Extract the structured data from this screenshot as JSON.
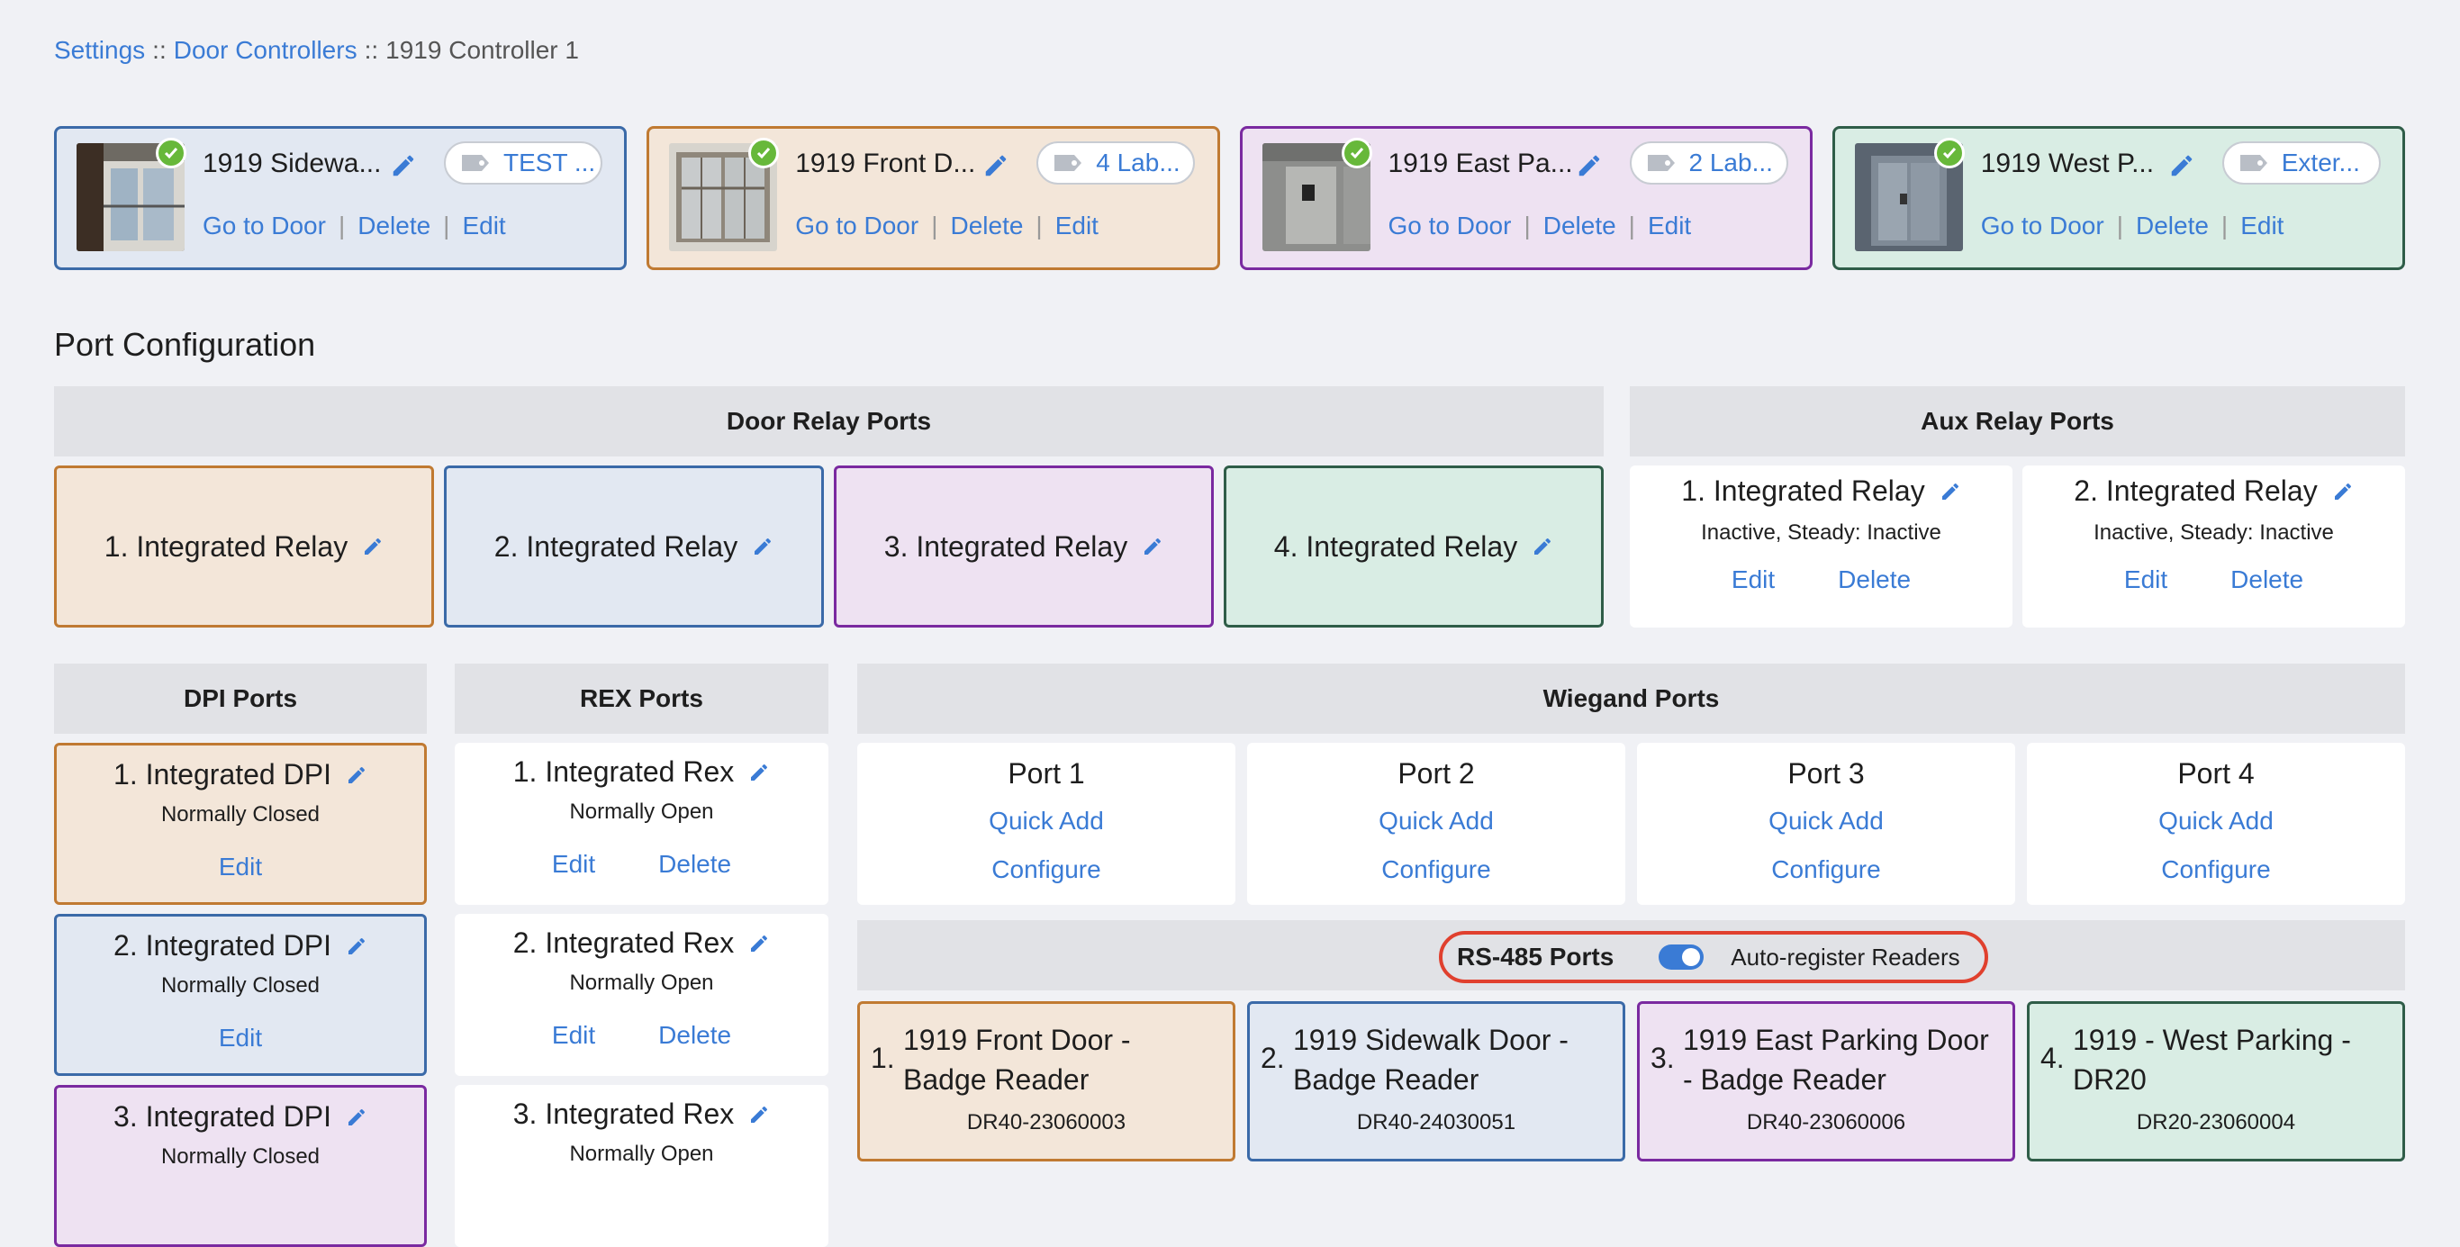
{
  "breadcrumb": {
    "items": [
      "Settings",
      "Door Controllers"
    ],
    "current": "1919 Controller 1",
    "separator": "::"
  },
  "door_cards": [
    {
      "name": "1919 Sidewa...",
      "tag": "TEST ...",
      "go": "Go to Door",
      "del": "Delete",
      "edit": "Edit",
      "color": "#3b6aa8",
      "bg": "#e2e8f2"
    },
    {
      "name": "1919 Front D...",
      "tag": "4 Lab...",
      "go": "Go to Door",
      "del": "Delete",
      "edit": "Edit",
      "color": "#c07a32",
      "bg": "#f3e6d9"
    },
    {
      "name": "1919 East Pa...",
      "tag": "2 Lab...",
      "go": "Go to Door",
      "del": "Delete",
      "edit": "Edit",
      "color": "#7a2aa0",
      "bg": "#eee2f2"
    },
    {
      "name": "1919 West P...",
      "tag": "Exter...",
      "go": "Go to Door",
      "del": "Delete",
      "edit": "Edit",
      "color": "#2f5d48",
      "bg": "#d9ede4"
    }
  ],
  "section_title": "Port Configuration",
  "door_relay": {
    "header": "Door Relay Ports",
    "items": [
      "1. Integrated Relay",
      "2. Integrated Relay",
      "3. Integrated Relay",
      "4. Integrated Relay"
    ]
  },
  "aux_relay": {
    "header": "Aux Relay Ports",
    "items": [
      {
        "title": "1. Integrated Relay",
        "status": "Inactive, Steady: Inactive",
        "edit": "Edit",
        "del": "Delete"
      },
      {
        "title": "2. Integrated Relay",
        "status": "Inactive, Steady: Inactive",
        "edit": "Edit",
        "del": "Delete"
      }
    ]
  },
  "dpi": {
    "header": "DPI Ports",
    "items": [
      {
        "title": "1. Integrated DPI",
        "status": "Normally Closed",
        "edit": "Edit"
      },
      {
        "title": "2. Integrated DPI",
        "status": "Normally Closed",
        "edit": "Edit"
      },
      {
        "title": "3. Integrated DPI",
        "status": "Normally Closed"
      }
    ]
  },
  "rex": {
    "header": "REX Ports",
    "items": [
      {
        "title": "1. Integrated Rex",
        "status": "Normally Open",
        "edit": "Edit",
        "del": "Delete"
      },
      {
        "title": "2. Integrated Rex",
        "status": "Normally Open",
        "edit": "Edit",
        "del": "Delete"
      },
      {
        "title": "3. Integrated Rex",
        "status": "Normally Open"
      }
    ]
  },
  "wiegand": {
    "header": "Wiegand Ports",
    "items": [
      {
        "title": "Port 1",
        "quick": "Quick Add",
        "configure": "Configure"
      },
      {
        "title": "Port 2",
        "quick": "Quick Add",
        "configure": "Configure"
      },
      {
        "title": "Port 3",
        "quick": "Quick Add",
        "configure": "Configure"
      },
      {
        "title": "Port 4",
        "quick": "Quick Add",
        "configure": "Configure"
      }
    ]
  },
  "rs485": {
    "label": "RS-485 Ports",
    "auto_register": "Auto-register Readers",
    "auto_register_enabled": true,
    "readers": [
      {
        "num": "1.",
        "name_line1": "1919 Front Door -",
        "name_line2": "Badge Reader",
        "serial": "DR40-23060003"
      },
      {
        "num": "2.",
        "name_line1": "1919 Sidewalk Door -",
        "name_line2": "Badge Reader",
        "serial": "DR40-24030051"
      },
      {
        "num": "3.",
        "name_line1": "1919 East Parking Door",
        "name_line2": "- Badge Reader",
        "serial": "DR40-23060006"
      },
      {
        "num": "4.",
        "name_line1": "1919 - West Parking -",
        "name_line2": "DR20",
        "serial": "DR20-23060004"
      }
    ]
  },
  "colors": {
    "orange": "#c07a32",
    "orange_bg": "#f3e6d9",
    "blue": "#3b6aa8",
    "blue_bg": "#e2e8f2",
    "purple": "#7a2aa0",
    "purple_bg": "#eee2f2",
    "green": "#2f5d48",
    "green_bg": "#d9ede4",
    "link": "#3a7bd5",
    "highlight": "#e0402e"
  }
}
